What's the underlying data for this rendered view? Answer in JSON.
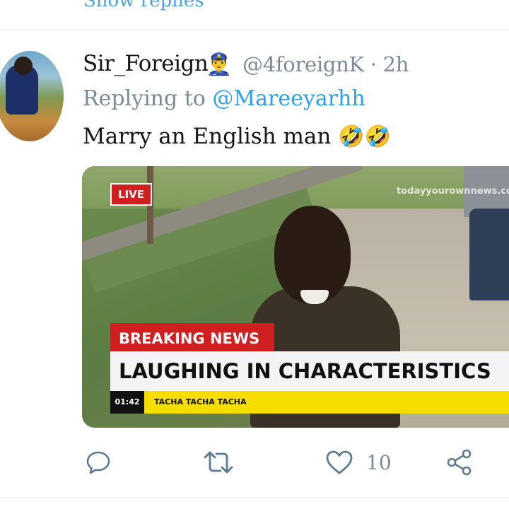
{
  "thread": {
    "show_replies_label": "Show replies"
  },
  "tweet": {
    "display_name": "Sir_Foreign",
    "name_emoji": "👮‍♂️",
    "handle": "@4foreignK",
    "separator": "·",
    "time": "2h",
    "replying_to_prefix": "Replying to",
    "replying_to_mention": "@Mareeyarhh",
    "text": "Marry an English man",
    "text_emoji": "🤣🤣"
  },
  "media": {
    "live_label": "LIVE",
    "watermark": "todayyourownnews.com",
    "breaking_label": "BREAKING NEWS",
    "headline": "LAUGHING IN CHARACTERISTICS",
    "clock": "01:42",
    "ticker": "TACHA TACHA TACHA"
  },
  "actions": {
    "reply_icon": "reply-icon",
    "retweet_icon": "retweet-icon",
    "like_icon": "heart-icon",
    "like_count": "10",
    "share_icon": "share-icon"
  },
  "colors": {
    "link": "#2aa0f0",
    "muted": "#7b8a96",
    "icon": "#5e7a8f",
    "breaking_red": "#d01f1f",
    "ticker_yellow": "#f5dd00"
  }
}
